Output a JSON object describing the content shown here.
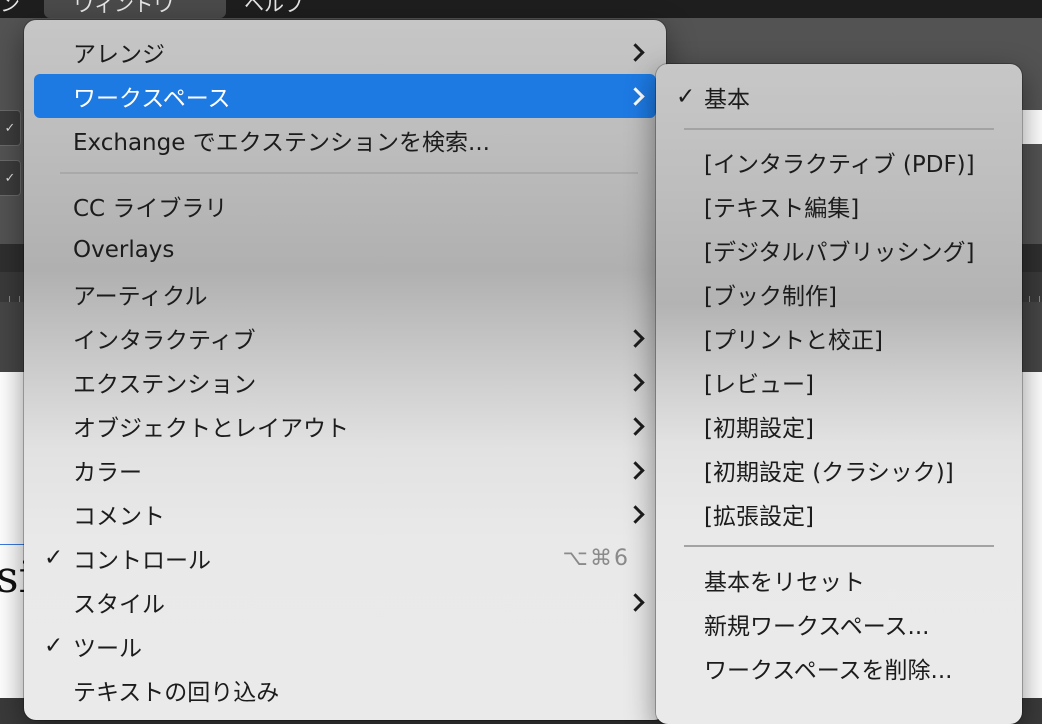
{
  "menubar": {
    "left_title": "ン",
    "active_title": "ウィンドウ",
    "right_title": "ヘルプ"
  },
  "toolbar": {
    "checkmark": "✓"
  },
  "document": {
    "visible_text": "si"
  },
  "main_menu": {
    "items": [
      {
        "label": "アレンジ",
        "has_submenu": true,
        "checked": false,
        "highlighted": false
      },
      {
        "label": "ワークスペース",
        "has_submenu": true,
        "checked": false,
        "highlighted": true
      },
      {
        "label": "Exchange でエクステンションを検索...",
        "has_submenu": false,
        "checked": false,
        "highlighted": false
      },
      {
        "label": "CC ライブラリ",
        "has_submenu": false,
        "checked": false,
        "highlighted": false
      },
      {
        "label": "Overlays",
        "has_submenu": false,
        "checked": false,
        "highlighted": false
      },
      {
        "label": "アーティクル",
        "has_submenu": false,
        "checked": false,
        "highlighted": false
      },
      {
        "label": "インタラクティブ",
        "has_submenu": true,
        "checked": false,
        "highlighted": false
      },
      {
        "label": "エクステンション",
        "has_submenu": true,
        "checked": false,
        "highlighted": false
      },
      {
        "label": "オブジェクトとレイアウト",
        "has_submenu": true,
        "checked": false,
        "highlighted": false
      },
      {
        "label": "カラー",
        "has_submenu": true,
        "checked": false,
        "highlighted": false
      },
      {
        "label": "コメント",
        "has_submenu": true,
        "checked": false,
        "highlighted": false
      },
      {
        "label": "コントロール",
        "has_submenu": false,
        "checked": true,
        "highlighted": false,
        "shortcut": "⌥⌘6"
      },
      {
        "label": "スタイル",
        "has_submenu": true,
        "checked": false,
        "highlighted": false
      },
      {
        "label": "ツール",
        "has_submenu": false,
        "checked": true,
        "highlighted": false
      },
      {
        "label": "テキストの回り込み",
        "has_submenu": false,
        "checked": false,
        "highlighted": false
      }
    ],
    "check_mark": "✓"
  },
  "workspace_submenu": {
    "items": [
      {
        "label": "基本",
        "checked": true
      },
      {
        "label": "[インタラクティブ (PDF)]",
        "checked": false
      },
      {
        "label": "[テキスト編集]",
        "checked": false
      },
      {
        "label": "[デジタルパブリッシング]",
        "checked": false
      },
      {
        "label": "[ブック制作]",
        "checked": false
      },
      {
        "label": "[プリントと校正]",
        "checked": false
      },
      {
        "label": "[レビュー]",
        "checked": false
      },
      {
        "label": "[初期設定]",
        "checked": false
      },
      {
        "label": "[初期設定 (クラシック)]",
        "checked": false
      },
      {
        "label": "[拡張設定]",
        "checked": false
      },
      {
        "label": "基本をリセット",
        "checked": false
      },
      {
        "label": "新規ワークスペース...",
        "checked": false
      },
      {
        "label": "ワークスペースを削除...",
        "checked": false
      }
    ],
    "check_mark": "✓"
  },
  "colors": {
    "highlight": "#1d7ae3",
    "menu_text": "#1c1c1c",
    "shortcut_text": "#8a8a8a"
  }
}
